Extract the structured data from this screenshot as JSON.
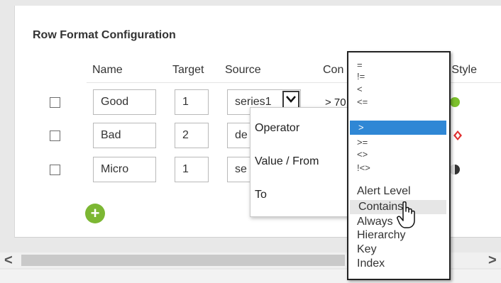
{
  "panel": {
    "title": "Row Format Configuration",
    "columns": {
      "name": "Name",
      "target": "Target",
      "source": "Source",
      "condition": "Con",
      "style": "Style"
    }
  },
  "rows": [
    {
      "name": "Good",
      "target": "1",
      "source": "series1",
      "condition": "> 70",
      "style_color": "#7cc02c"
    },
    {
      "name": "Bad",
      "target": "2",
      "source": "de",
      "condition": "",
      "style_color": "#e03030"
    },
    {
      "name": "Micro",
      "target": "1",
      "source": "se",
      "condition": "",
      "style_color": "#333333"
    }
  ],
  "popup": {
    "operator_label": "Operator",
    "value_label": "Value / From",
    "to_label": "To"
  },
  "operator_options": [
    "=",
    "!=",
    "<",
    "<=",
    ">",
    ">=",
    "<>",
    "!<>",
    "Alert Level",
    "Contains",
    "Always",
    "Hierarchy",
    "Key",
    "Index"
  ],
  "operator_selected": ">",
  "operator_hover": "Contains",
  "add_button": "+",
  "scroll": {
    "left": "<",
    "right": ">"
  },
  "colors": {
    "accent_blue": "#2f87d5",
    "add_green": "#7cb733"
  }
}
